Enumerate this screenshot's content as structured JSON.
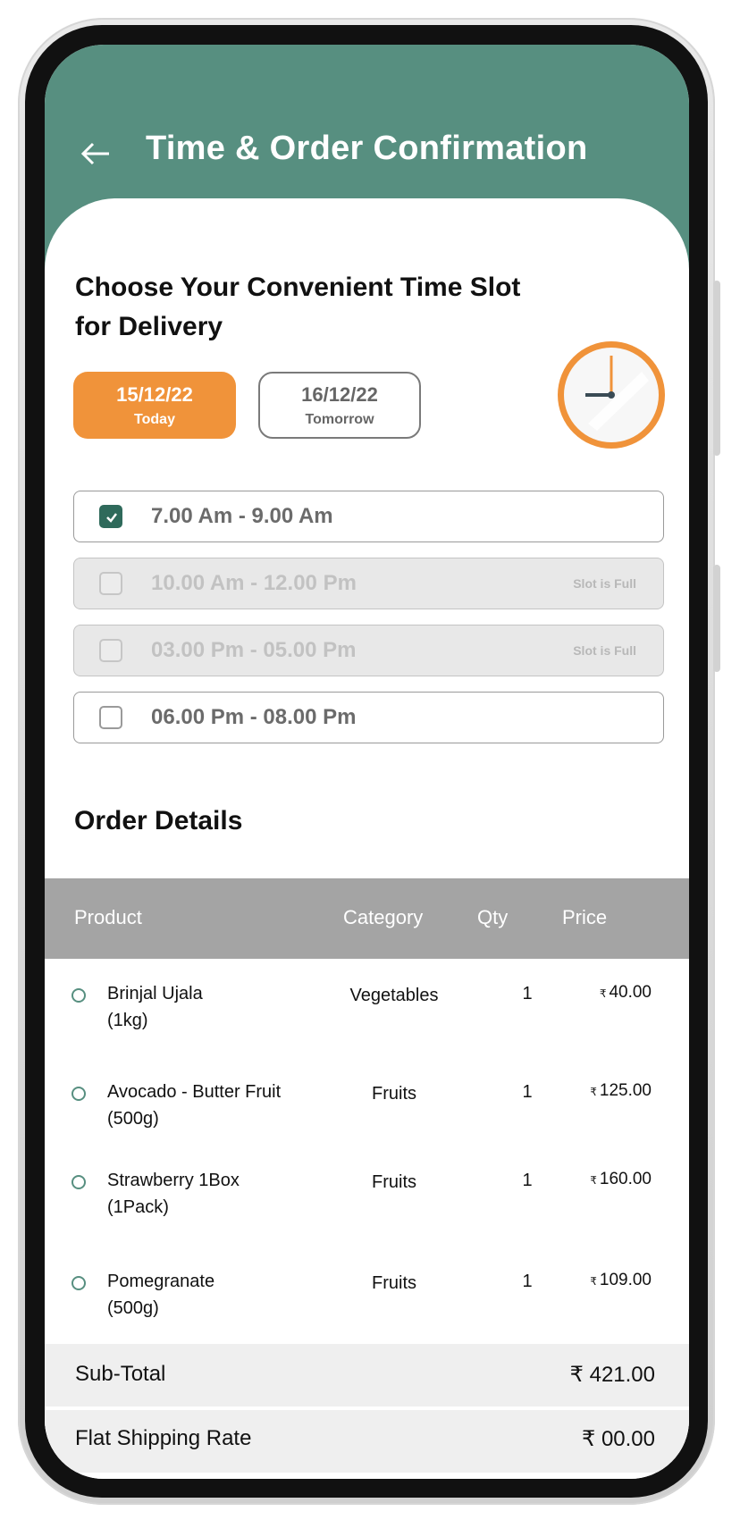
{
  "header": {
    "title": "Time & Order Confirmation"
  },
  "time_slot": {
    "heading": "Choose Your Convenient Time Slot for Delivery",
    "dates": [
      {
        "date": "15/12/22",
        "label": "Today",
        "selected": true
      },
      {
        "date": "16/12/22",
        "label": "Tomorrow",
        "selected": false
      }
    ],
    "slots": [
      {
        "time": "7.00 Am - 9.00 Am",
        "checked": true,
        "full": false,
        "note": ""
      },
      {
        "time": "10.00 Am - 12.00 Pm",
        "checked": false,
        "full": true,
        "note": "Slot is Full"
      },
      {
        "time": "03.00 Pm - 05.00 Pm",
        "checked": false,
        "full": true,
        "note": "Slot is Full"
      },
      {
        "time": "06.00 Pm - 08.00 Pm",
        "checked": false,
        "full": false,
        "note": ""
      }
    ]
  },
  "order": {
    "title": "Order Details",
    "columns": {
      "product": "Product",
      "category": "Category",
      "qty": "Qty",
      "price": "Price"
    },
    "items": [
      {
        "name": "Brinjal Ujala",
        "unit": "(1kg)",
        "category": "Vegetables",
        "qty": "1",
        "price": "40.00"
      },
      {
        "name": "Avocado - Butter Fruit",
        "unit": "(500g)",
        "category": "Fruits",
        "qty": "1",
        "price": "125.00"
      },
      {
        "name": "Strawberry 1Box",
        "unit": "(1Pack)",
        "category": "Fruits",
        "qty": "1",
        "price": "160.00"
      },
      {
        "name": "Pomegranate",
        "unit": "(500g)",
        "category": "Fruits",
        "qty": "1",
        "price": "109.00"
      }
    ],
    "currency": "₹",
    "subtotal": {
      "label": "Sub-Total",
      "value": "₹ 421.00"
    },
    "shipping": {
      "label": "Flat Shipping Rate",
      "value": "₹ 00.00"
    }
  },
  "colors": {
    "header": "#578f80",
    "accent": "#f0933a",
    "check": "#2f6a5b"
  },
  "icons": [
    "arrow-left-icon",
    "clock-icon",
    "check-icon",
    "circle-bullet-icon"
  ]
}
